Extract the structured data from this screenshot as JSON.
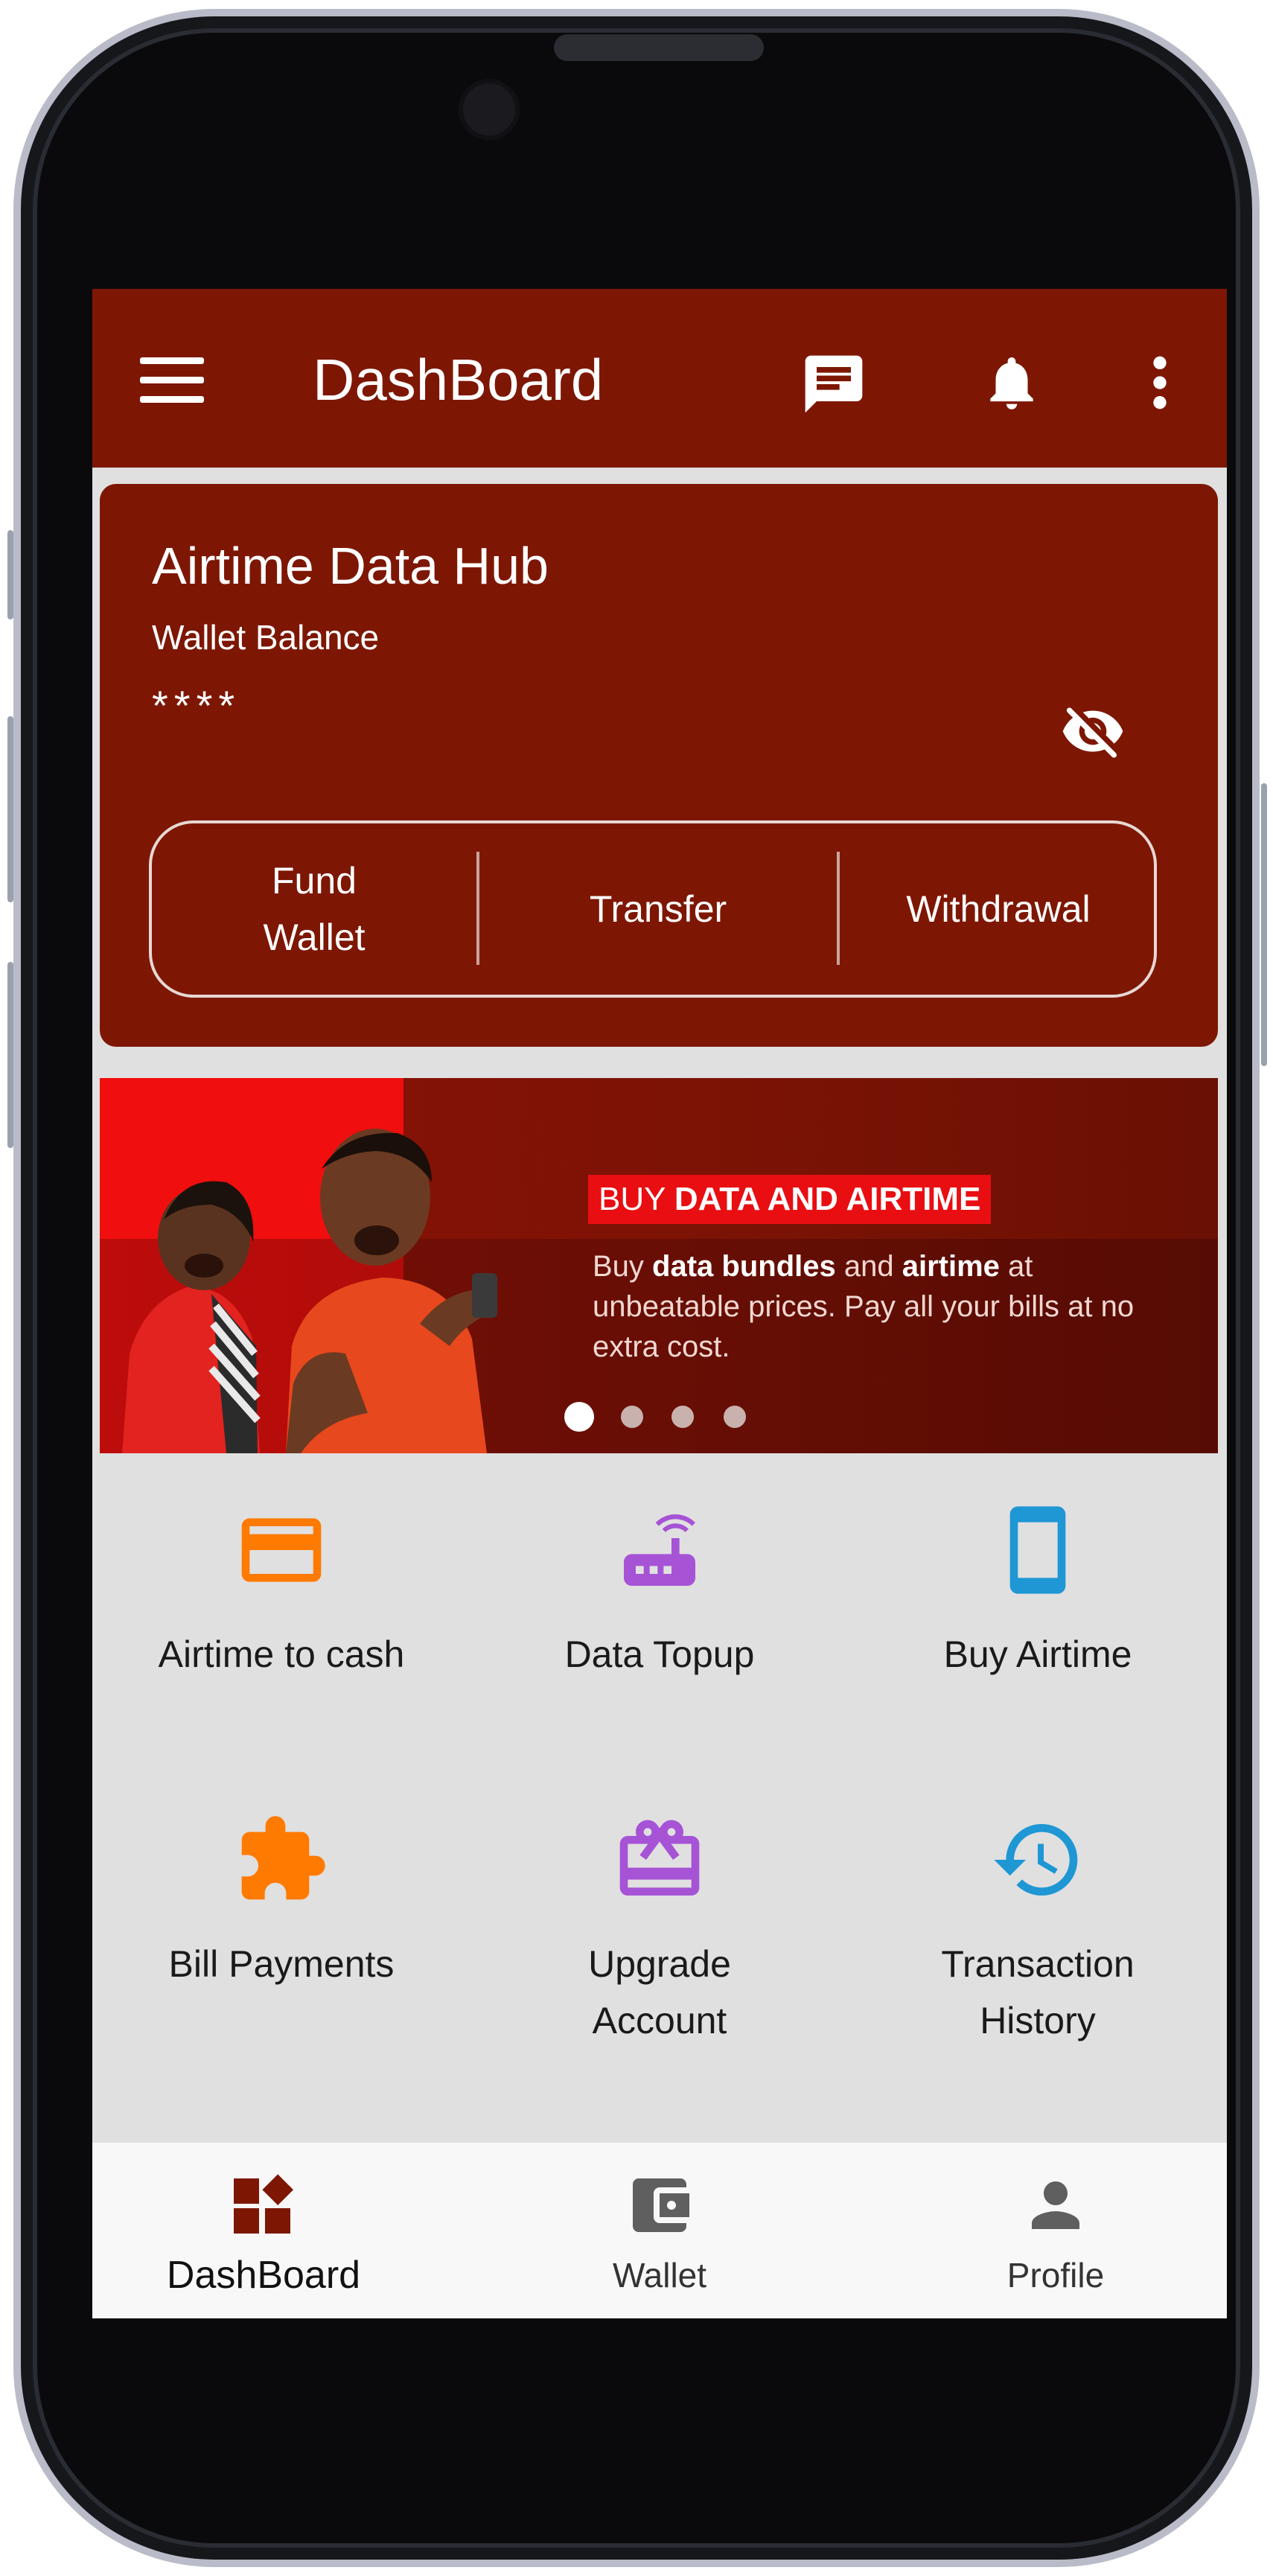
{
  "appbar": {
    "title": "DashBoard",
    "icons": [
      "menu-icon",
      "chat-icon",
      "bell-icon",
      "more-vert-icon"
    ]
  },
  "wallet": {
    "brand": "Airtime Data Hub",
    "label": "Wallet Balance",
    "balance_masked": "****",
    "visibility_icon": "eye-off-icon",
    "actions": [
      "Fund\nWallet",
      "Transfer",
      "Withdrawal"
    ]
  },
  "banner": {
    "tag_prefix": "BUY ",
    "tag_bold": "DATA AND AIRTIME",
    "desc_1": "Buy ",
    "desc_2": "data bundles",
    "desc_3": " and ",
    "desc_4": "airtime",
    "desc_5": " at unbeatable prices. Pay all your bills at no extra cost.",
    "slides_total": 4,
    "slide_active": 1
  },
  "services": [
    {
      "label": "Airtime to cash",
      "icon": "credit-card-icon",
      "color": "#ff7a00"
    },
    {
      "label": "Data Topup",
      "icon": "router-icon",
      "color": "#a653d6"
    },
    {
      "label": "Buy Airtime",
      "icon": "smartphone-icon",
      "color": "#1e97d4"
    },
    {
      "label": "Bill Payments",
      "icon": "puzzle-icon",
      "color": "#ff7a00"
    },
    {
      "label": "Upgrade\nAccount",
      "icon": "gift-card-icon",
      "color": "#a653d6"
    },
    {
      "label": "Transaction\nHistory",
      "icon": "history-icon",
      "color": "#1e97d4"
    }
  ],
  "bottom_nav": [
    {
      "label": "DashBoard",
      "icon": "dashboard-icon",
      "active": true
    },
    {
      "label": "Wallet",
      "icon": "wallet-icon",
      "active": false
    },
    {
      "label": "Profile",
      "icon": "person-icon",
      "active": false
    }
  ],
  "colors": {
    "primary": "#7d1704",
    "banner_red": "#f10e0e",
    "orange": "#ff7a00",
    "purple": "#a653d6",
    "blue": "#1e97d4",
    "screen_bg": "#e0e0e0",
    "nav_bg": "#f8f8f8"
  }
}
